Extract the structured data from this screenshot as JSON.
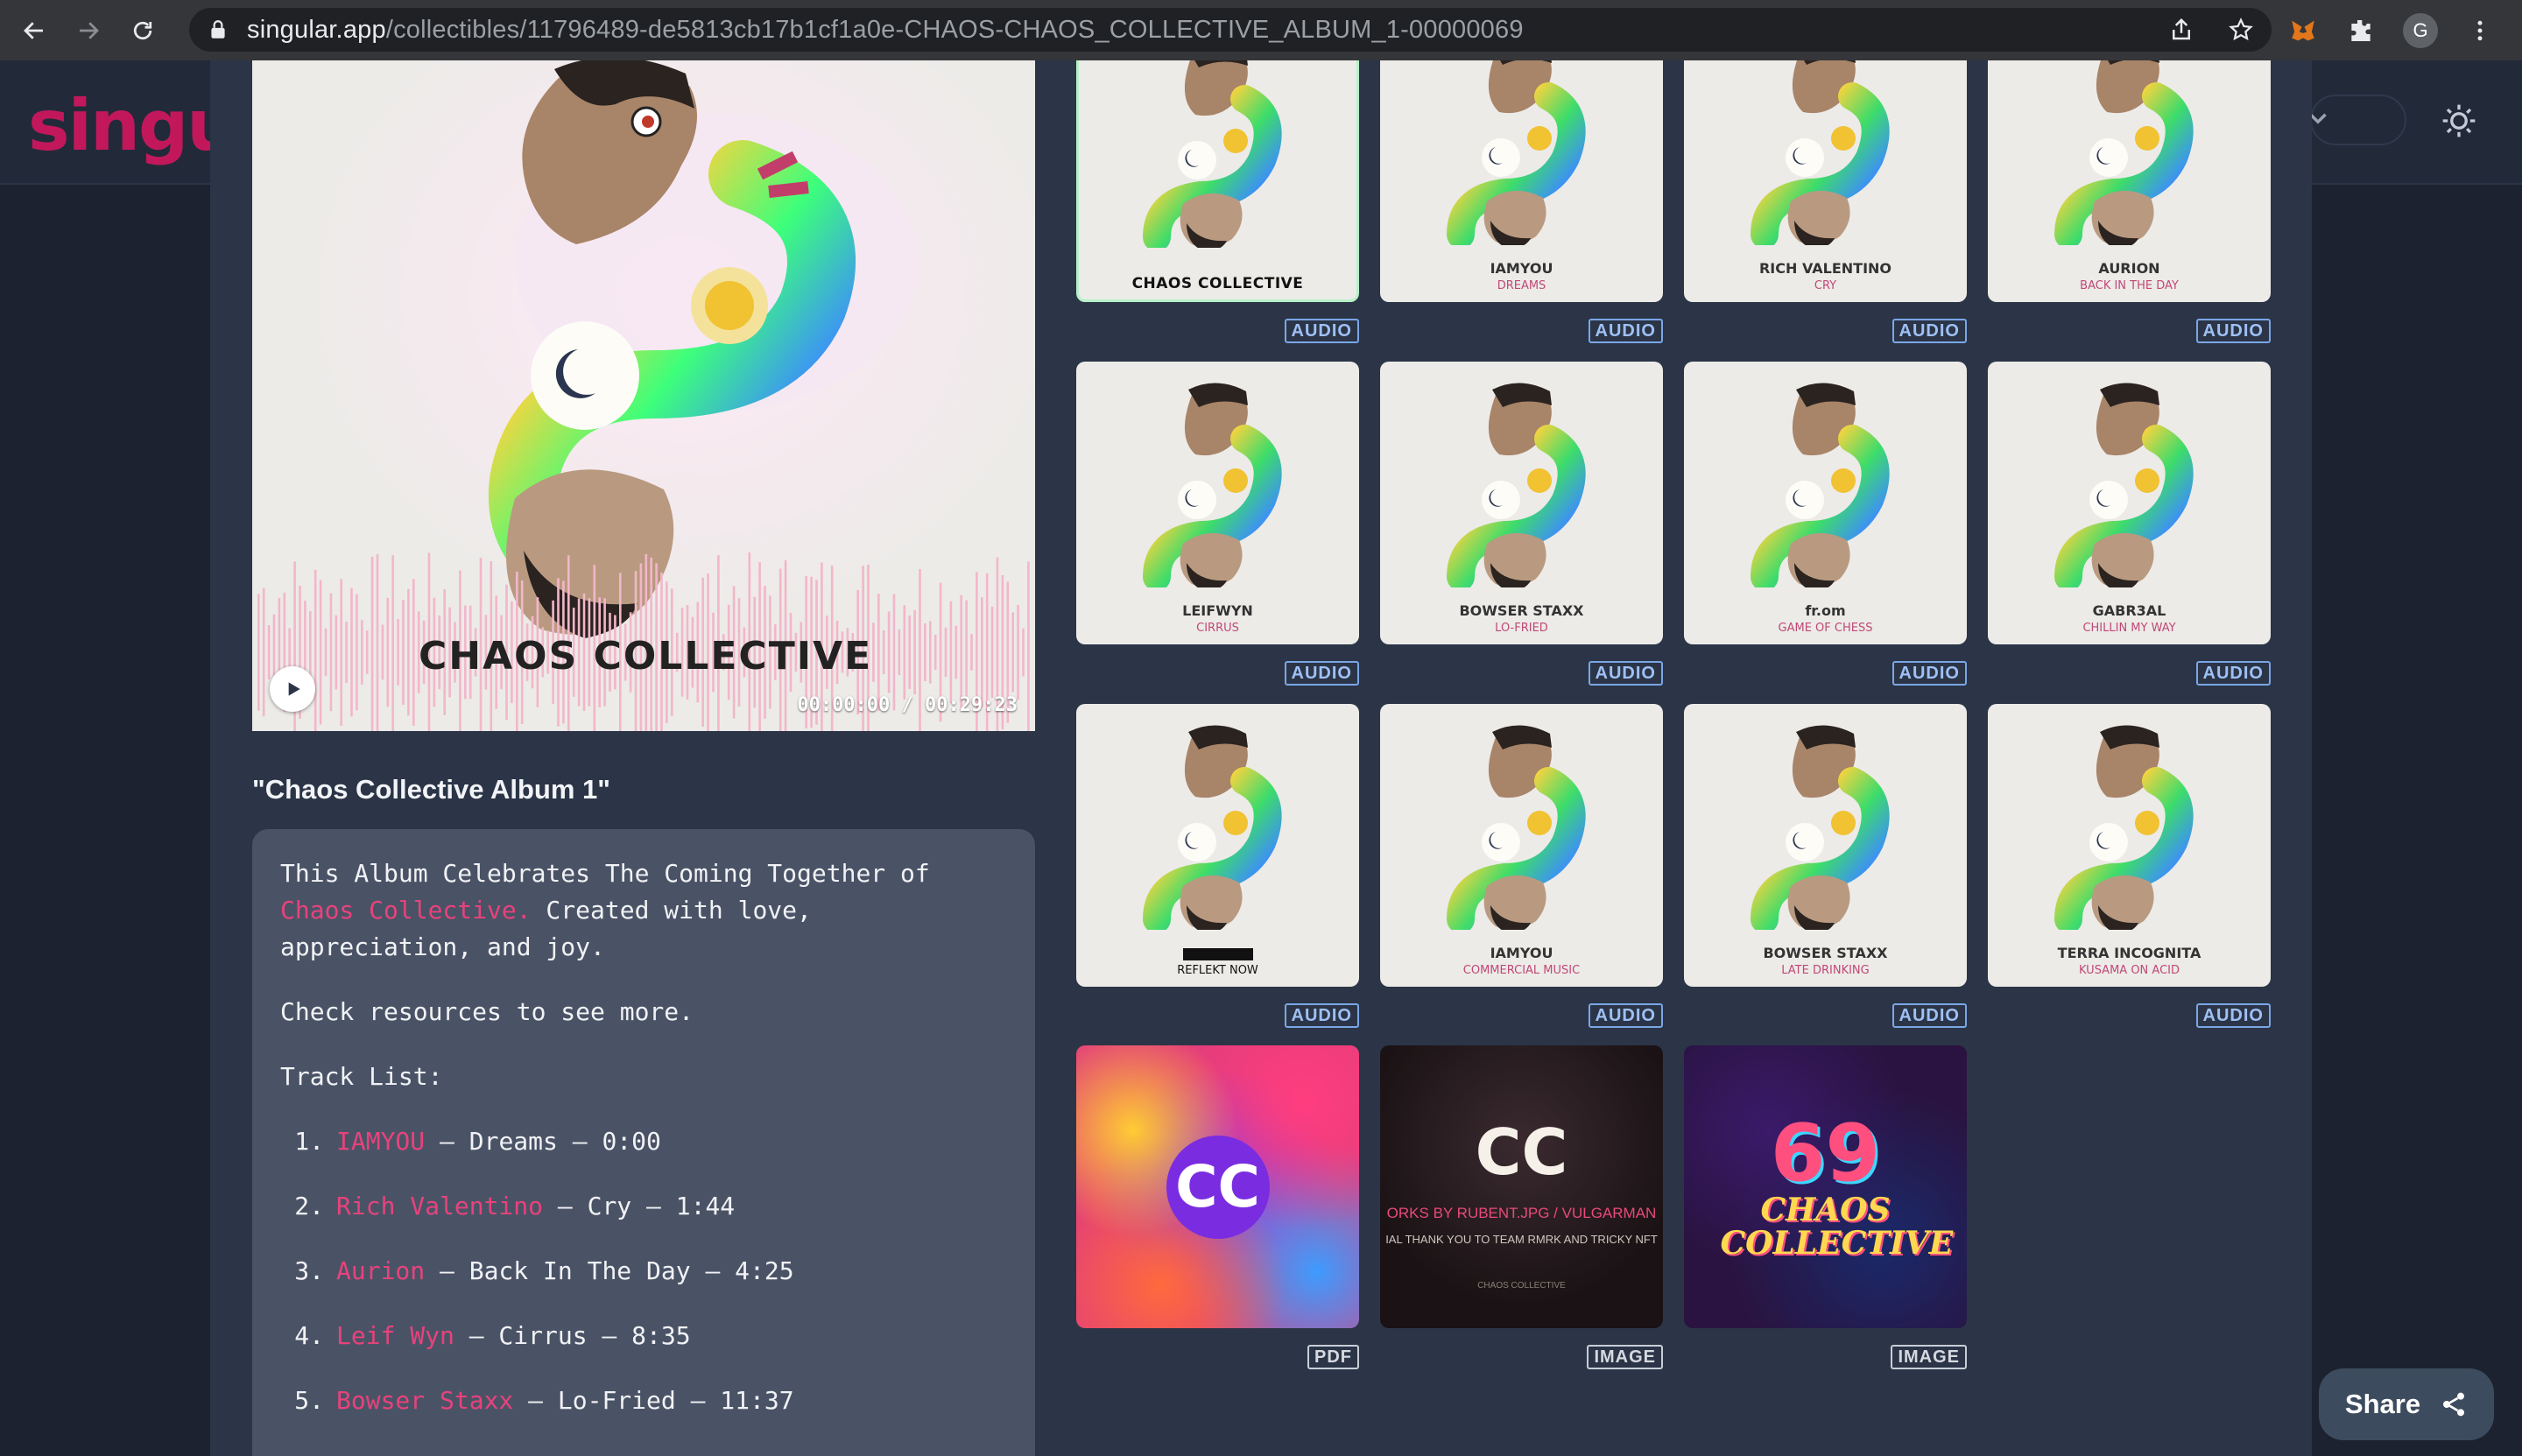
{
  "browser": {
    "url_host": "singular.app",
    "url_path": "/collectibles/11796489-de5813cb17b1cf1a0e-CHAOS-CHAOS_COLLECTIVE_ALBUM_1-00000069",
    "avatar_letter": "G"
  },
  "site": {
    "logo_text": "singul"
  },
  "player": {
    "cover_text": "CHAOS COLLECTIVE",
    "time": "00:00:00 / 00:29:23"
  },
  "album": {
    "title": "\"Chaos Collective Album 1\"",
    "desc_before": "This Album Celebrates The Coming Together of ",
    "desc_link": "Chaos Collective.",
    "desc_after": " Created with love, appreciation, and joy.",
    "resources_text": "Check resources to see more.",
    "tracklist_label": "Track List:",
    "tracks": [
      {
        "num": "1.",
        "artist": "IAMYOU",
        "rest": " – Dreams – 0:00"
      },
      {
        "num": "2.",
        "artist": "Rich Valentino",
        "rest": " – Cry – 1:44"
      },
      {
        "num": "3.",
        "artist": "Aurion",
        "rest": " – Back In The Day – 4:25"
      },
      {
        "num": "4.",
        "artist": "Leif Wyn",
        "rest": " – Cirrus – 8:35"
      },
      {
        "num": "5.",
        "artist": "Bowser Staxx",
        "rest": " – Lo-Fried – 11:37"
      }
    ]
  },
  "grid": {
    "items": [
      {
        "artist": "CHAOS COLLECTIVE",
        "track": "",
        "badge": "AUDIO",
        "style": "bold"
      },
      {
        "artist": "IAMYOU",
        "track": "DREAMS",
        "badge": "AUDIO"
      },
      {
        "artist": "RICH VALENTINO",
        "track": "CRY",
        "badge": "AUDIO"
      },
      {
        "artist": "AURION",
        "track": "BACK IN THE DAY",
        "badge": "AUDIO"
      },
      {
        "artist": "LEIFWYN",
        "track": "CIRRUS",
        "badge": "AUDIO"
      },
      {
        "artist": "BOWSER STAXX",
        "track": "LO-FRIED",
        "badge": "AUDIO"
      },
      {
        "artist": "fr.om",
        "track": "GAME OF CHESS",
        "badge": "AUDIO"
      },
      {
        "artist": "GABR3AL",
        "track": "CHILLIN MY WAY",
        "badge": "AUDIO"
      },
      {
        "artist": "",
        "track": "REFLEKT NOW",
        "badge": "AUDIO"
      },
      {
        "artist": "IAMYOU",
        "track": "COMMERCIAL MUSIC",
        "badge": "AUDIO"
      },
      {
        "artist": "BOWSER STAXX",
        "track": "LATE DRINKING",
        "badge": "AUDIO"
      },
      {
        "artist": "TERRA INCOGNITA",
        "track": "KUSAMA ON ACID",
        "badge": "AUDIO"
      }
    ],
    "extras": [
      {
        "badge": "PDF",
        "art_text": "CC"
      },
      {
        "badge": "IMAGE",
        "art_text": "CC",
        "line1": "ORKS BY RUBENT.JPG / VULGARMAN",
        "line2": "IAL THANK YOU TO TEAM RMRK AND TRICKY NFT",
        "line3": "CHAOS COLLECTIVE"
      },
      {
        "badge": "IMAGE",
        "art_text": "69",
        "art_sub": "CHAOS COLLECTIVE"
      }
    ]
  },
  "share": {
    "label": "Share"
  }
}
